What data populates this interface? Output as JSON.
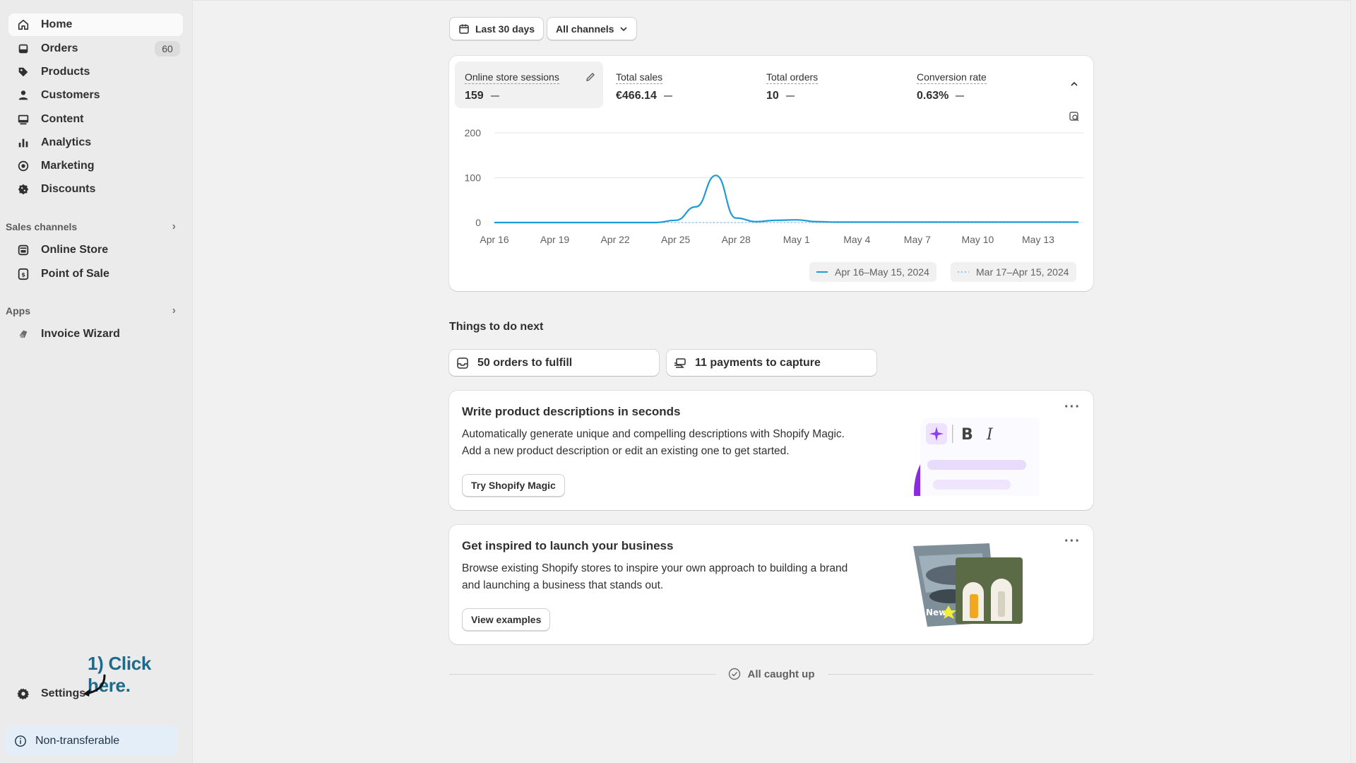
{
  "sidebar": {
    "items": [
      {
        "label": "Home",
        "icon": "home-icon"
      },
      {
        "label": "Orders",
        "icon": "inbox-icon",
        "badge": "60"
      },
      {
        "label": "Products",
        "icon": "tag-icon"
      },
      {
        "label": "Customers",
        "icon": "person-icon"
      },
      {
        "label": "Content",
        "icon": "image-icon"
      },
      {
        "label": "Analytics",
        "icon": "bar-chart-icon"
      },
      {
        "label": "Marketing",
        "icon": "target-icon"
      },
      {
        "label": "Discounts",
        "icon": "discount-icon"
      }
    ],
    "sales_channels_heading": "Sales channels",
    "sales_channels": [
      {
        "label": "Online Store",
        "icon": "store-icon"
      },
      {
        "label": "Point of Sale",
        "icon": "pos-icon"
      }
    ],
    "apps_heading": "Apps",
    "apps": [
      {
        "label": "Invoice Wizard",
        "icon": "app-icon"
      }
    ],
    "settings_label": "Settings",
    "non_transferable": "Non-transferable"
  },
  "annotation": "1) Click here.",
  "filters": {
    "date_range": "Last 30 days",
    "channel": "All channels"
  },
  "metrics": [
    {
      "label": "Online store sessions",
      "value": "159"
    },
    {
      "label": "Total sales",
      "value": "€466.14"
    },
    {
      "label": "Total orders",
      "value": "10"
    },
    {
      "label": "Conversion rate",
      "value": "0.63%"
    }
  ],
  "chart_data": {
    "type": "line",
    "x": [
      "Apr 16",
      "Apr 17",
      "Apr 18",
      "Apr 19",
      "Apr 20",
      "Apr 21",
      "Apr 22",
      "Apr 23",
      "Apr 24",
      "Apr 25",
      "Apr 26",
      "Apr 27",
      "Apr 28",
      "Apr 29",
      "Apr 30",
      "May 1",
      "May 2",
      "May 3",
      "May 4",
      "May 5",
      "May 6",
      "May 7",
      "May 8",
      "May 9",
      "May 10",
      "May 11",
      "May 12",
      "May 13",
      "May 14",
      "May 15"
    ],
    "x_ticks": [
      "Apr 16",
      "Apr 19",
      "Apr 22",
      "Apr 25",
      "Apr 28",
      "May 1",
      "May 4",
      "May 7",
      "May 10",
      "May 13"
    ],
    "y_ticks": [
      "0",
      "100",
      "200"
    ],
    "ylim": [
      0,
      200
    ],
    "series": [
      {
        "name": "Apr 16–May 15, 2024",
        "color": "#1d9bd8",
        "style": "solid",
        "values": [
          0,
          0,
          0,
          0,
          0,
          0,
          0,
          0,
          0,
          5,
          35,
          105,
          10,
          2,
          5,
          6,
          2,
          1,
          1,
          1,
          1,
          1,
          1,
          1,
          1,
          1,
          1,
          1,
          1,
          1
        ]
      },
      {
        "name": "Mar 17–Apr 15, 2024",
        "color": "#8fc7e8",
        "style": "dotted",
        "values": [
          0,
          0,
          0,
          0,
          0,
          0,
          0,
          0,
          0,
          0,
          0,
          0,
          0,
          0,
          0,
          0,
          0,
          0,
          0,
          0,
          0,
          0,
          0,
          0,
          0,
          0,
          0,
          0,
          0,
          0
        ]
      }
    ]
  },
  "things_to_do": {
    "heading": "Things to do next",
    "tasks": [
      {
        "label": "50 orders to fulfill",
        "icon": "inbox-icon"
      },
      {
        "label": "11 payments to capture",
        "icon": "payment-icon"
      }
    ]
  },
  "promos": [
    {
      "title": "Write product descriptions in seconds",
      "body_line1": "Automatically generate unique and compelling descriptions with Shopify Magic.",
      "body_line2": "Add a new product description or edit an existing one to get started.",
      "button": "Try Shopify Magic"
    },
    {
      "title": "Get inspired to launch your business",
      "body_line1": "Browse existing Shopify stores to inspire your own approach to building a brand",
      "body_line2": "and launching a business that stands out.",
      "button": "View examples",
      "illustration_text": "New"
    }
  ],
  "all_caught_up": "All caught up"
}
